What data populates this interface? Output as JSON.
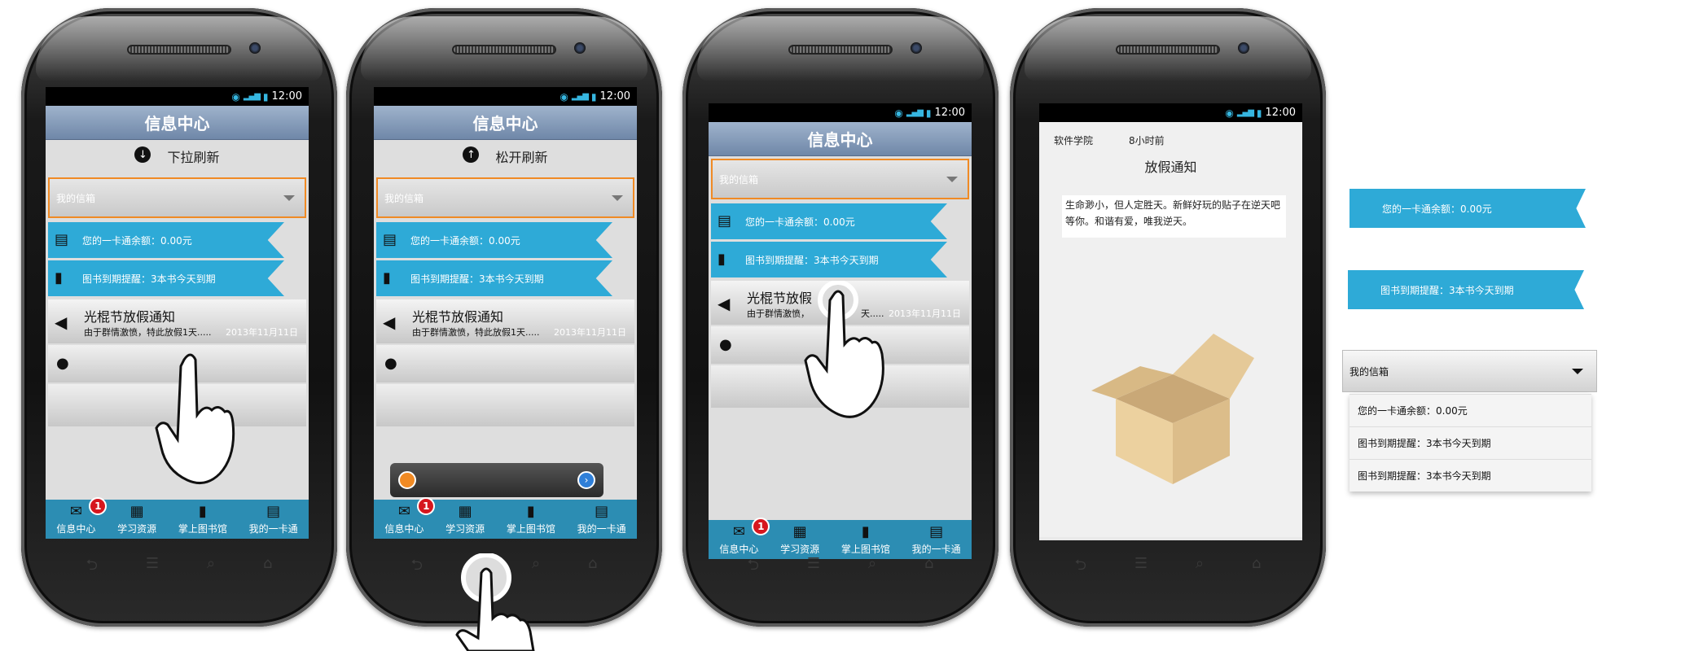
{
  "status_time": "12:00",
  "app": {
    "title": "信息中心",
    "pull_to_refresh": "下拉刷新",
    "release_to_refresh": "松开刷新",
    "dropdown_label": "我的信箱",
    "card_balance": "您的一卡通余额：0.00元",
    "book_reminder": "图书到期提醒：3本书今天到期",
    "notice_title": "光棍节放假通知",
    "notice_sub": "由于群情激愤，特此放假1天.....",
    "notice_sub_short": "由于群情激愤，",
    "notice_sub_tail": "天.....",
    "notice_title_short": "光棍节放假",
    "notice_date": "2013年11月11日",
    "badge": "1",
    "tabs": [
      "信息中心",
      "学习资源",
      "掌上图书馆",
      "我的一卡通"
    ]
  },
  "detail": {
    "source": "软件学院",
    "time": "8小时前",
    "title": "放假通知",
    "body": "生命渺小，但人定胜天。新鲜好玩的贴子在逆天吧等你。和谐有爱，唯我逆天。"
  },
  "extras": {
    "ribbon_balance": "您的一卡通余额：0.00元",
    "ribbon_book": "图书到期提醒：3本书今天到期",
    "dropdown_label": "我的信箱",
    "dropdown_items": [
      "您的一卡通余额：0.00元",
      "图书到期提醒：3本书今天到期",
      "图书到期提醒：3本书今天到期"
    ]
  }
}
